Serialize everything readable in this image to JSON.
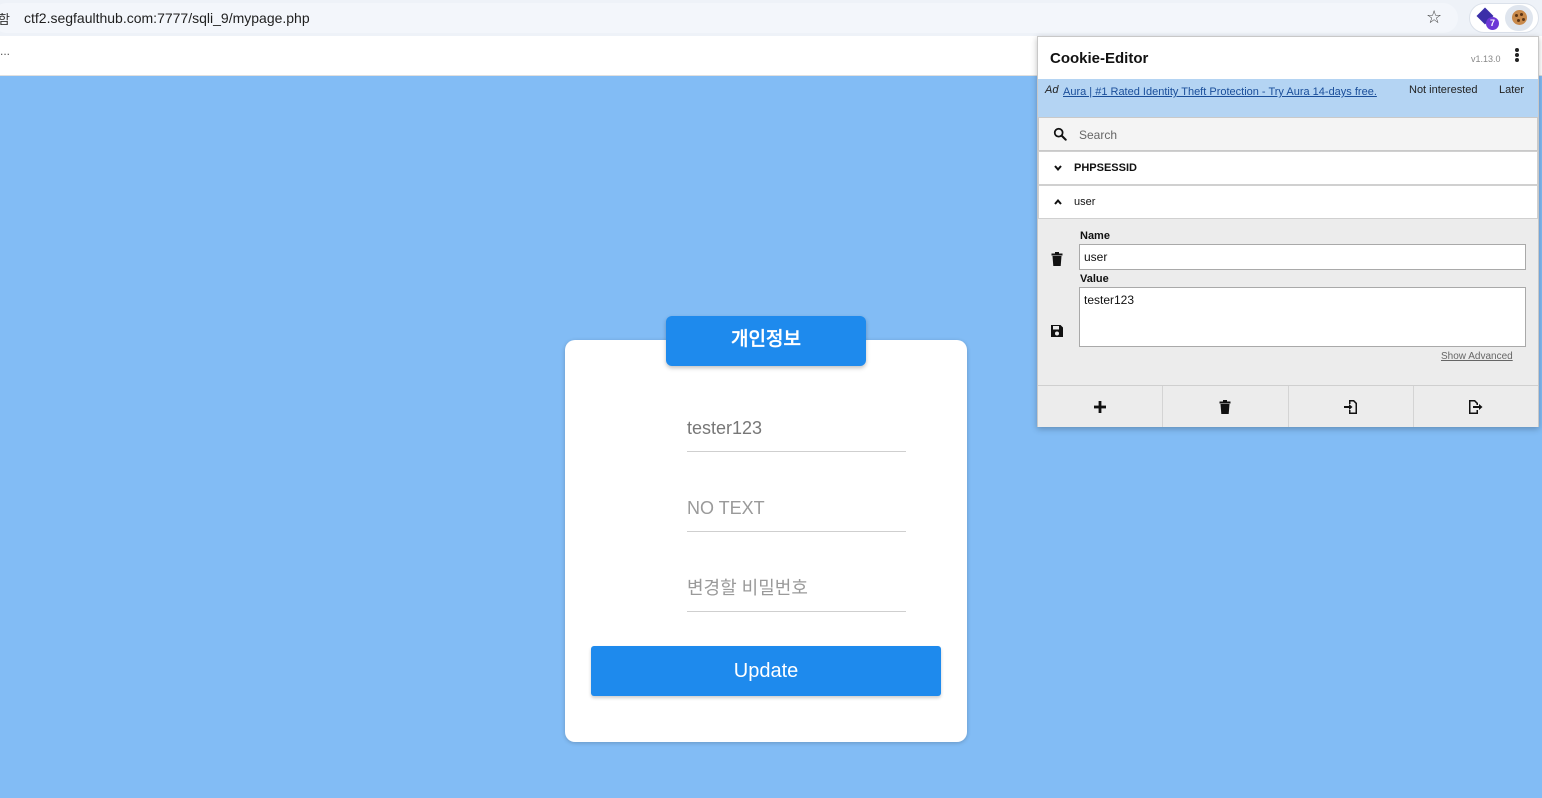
{
  "browser": {
    "site_icon_char": "함",
    "url": "ctf2.segfaulthub.com:7777/sqli_9/mypage.php",
    "star_icon": "☆",
    "bookmarks_overflow": "..."
  },
  "page": {
    "title": "개인정보",
    "fields": {
      "username_value": "tester123",
      "second_placeholder": "NO TEXT",
      "password_placeholder": "변경할 비밀번호"
    },
    "update_label": "Update"
  },
  "cookie_editor": {
    "title": "Cookie-Editor",
    "version": "v1.13.0",
    "ad": {
      "tag": "Ad",
      "link_text": "Aura | #1 Rated Identity Theft Protection - Try Aura 14-days free.",
      "not_interested": "Not interested",
      "later": "Later"
    },
    "search_placeholder": "Search",
    "cookies": [
      {
        "name": "PHPSESSID",
        "expanded": false
      },
      {
        "name": "user",
        "expanded": true
      }
    ],
    "editor": {
      "name_label": "Name",
      "name_value": "user",
      "value_label": "Value",
      "value_value": "tester123",
      "show_advanced": "Show Advanced"
    },
    "toolbar_icons": [
      "plus-icon",
      "trash-icon",
      "import-icon",
      "export-icon"
    ]
  },
  "colors": {
    "page_background": "#82bcf5",
    "accent_blue": "#1e8aed",
    "ad_background": "#b4d4f3"
  }
}
